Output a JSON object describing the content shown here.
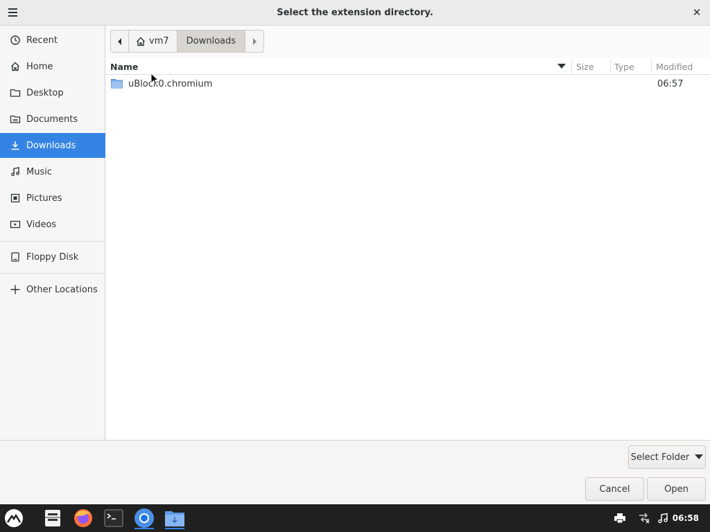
{
  "window": {
    "title": "Select the extension directory."
  },
  "sidebar": {
    "items": [
      {
        "label": "Recent",
        "icon": "clock-icon"
      },
      {
        "label": "Home",
        "icon": "home-icon"
      },
      {
        "label": "Desktop",
        "icon": "folder-icon"
      },
      {
        "label": "Documents",
        "icon": "document-icon"
      },
      {
        "label": "Downloads",
        "icon": "download-icon",
        "active": true
      },
      {
        "label": "Music",
        "icon": "music-icon"
      },
      {
        "label": "Pictures",
        "icon": "picture-icon"
      },
      {
        "label": "Videos",
        "icon": "video-icon"
      },
      {
        "label": "Floppy Disk",
        "icon": "drive-icon"
      },
      {
        "label": "Other Locations",
        "icon": "plus-icon"
      }
    ]
  },
  "pathbar": {
    "home_label": "vm7",
    "current_label": "Downloads"
  },
  "file_list": {
    "columns": {
      "name": "Name",
      "size": "Size",
      "type": "Type",
      "modified": "Modified"
    },
    "rows": [
      {
        "name": "uBlock0.chromium",
        "size": "",
        "type": "",
        "modified": "06:57",
        "icon": "folder-icon"
      }
    ]
  },
  "bottom": {
    "select_folder_label": "Select Folder",
    "cancel_label": "Cancel",
    "open_label": "Open"
  },
  "taskbar": {
    "clock": "06:58",
    "apps": [
      "start-menu-icon",
      "file-cabinet-icon",
      "firefox-icon",
      "terminal-icon",
      "chromium-icon",
      "files-download-icon"
    ]
  },
  "colors": {
    "accent": "#3584e4",
    "taskbar_bg": "#202020"
  }
}
